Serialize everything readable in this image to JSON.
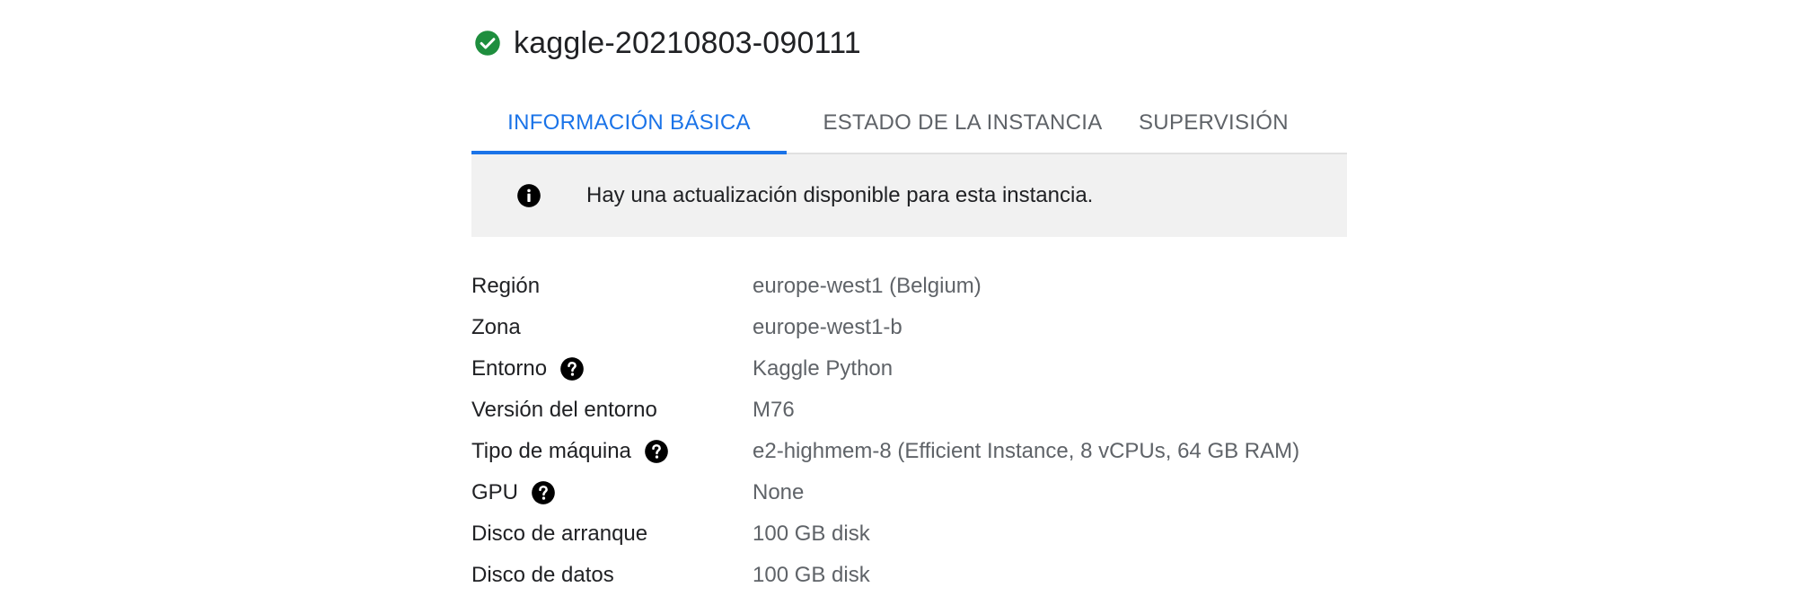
{
  "header": {
    "status": "running",
    "status_color": "#1e8e3e",
    "title": "kaggle-20210803-090111"
  },
  "tabs": [
    {
      "label": "INFORMACIÓN BÁSICA",
      "active": true
    },
    {
      "label": "ESTADO DE LA INSTANCIA",
      "active": false
    },
    {
      "label": "SUPERVISIÓN",
      "active": false
    }
  ],
  "accent_color": "#1a73e8",
  "banner": {
    "icon": "info-icon",
    "text": "Hay una actualización disponible para esta instancia."
  },
  "details": [
    {
      "label": "Región",
      "value": "europe-west1 (Belgium)",
      "help": false
    },
    {
      "label": "Zona",
      "value": "europe-west1-b",
      "help": false
    },
    {
      "label": "Entorno",
      "value": "Kaggle Python",
      "help": true
    },
    {
      "label": "Versión del entorno",
      "value": "M76",
      "help": false
    },
    {
      "label": "Tipo de máquina",
      "value": "e2-highmem-8 (Efficient Instance, 8 vCPUs, 64 GB RAM)",
      "help": true
    },
    {
      "label": "GPU",
      "value": "None",
      "help": true
    },
    {
      "label": "Disco de arranque",
      "value": "100 GB disk",
      "help": false
    },
    {
      "label": "Disco de datos",
      "value": "100 GB disk",
      "help": false
    }
  ]
}
